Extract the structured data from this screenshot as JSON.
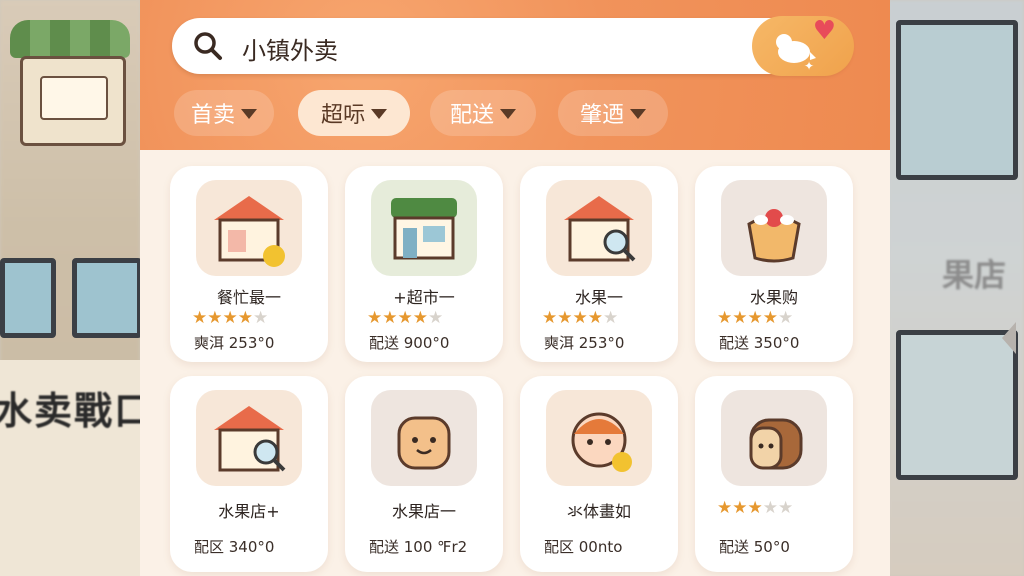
{
  "search": {
    "query": "小镇外卖"
  },
  "filters": [
    {
      "label": "首卖"
    },
    {
      "label": "超呩"
    },
    {
      "label": "配送"
    },
    {
      "label": "肇迺"
    }
  ],
  "shops": [
    {
      "name": "餐忙最一",
      "rating": 4,
      "fee": "奭洱 253°0",
      "thumb": "shop-search-icon"
    },
    {
      "name": "+超市一",
      "rating": 4,
      "fee": "配送 900°0",
      "thumb": "store-icon"
    },
    {
      "name": "水果一",
      "rating": 4,
      "fee": "奭洱 253°0",
      "thumb": "shop-search-icon"
    },
    {
      "name": "水果购",
      "rating": 4,
      "fee": "配送 350°0",
      "thumb": "cake-icon"
    },
    {
      "name": "水果店+",
      "rating": 0,
      "fee": "配区 340°0",
      "thumb": "shop-search-icon"
    },
    {
      "name": "水果店一",
      "rating": 0,
      "fee": "配送 100 ℉r2",
      "thumb": "bread-face-icon"
    },
    {
      "name": "氺体畫如",
      "rating": 0,
      "fee": "配区 00nto",
      "thumb": "kid-face-icon"
    },
    {
      "name": "",
      "rating": 3,
      "fee": "配送 50°0",
      "thumb": "bread-loaf-icon"
    }
  ],
  "background": {
    "poster_title": "水卖戰口",
    "right_sign": "果店"
  },
  "colors": {
    "accent": "#ee8a50",
    "star": "#e6982f",
    "panel": "#fbf1e7"
  }
}
